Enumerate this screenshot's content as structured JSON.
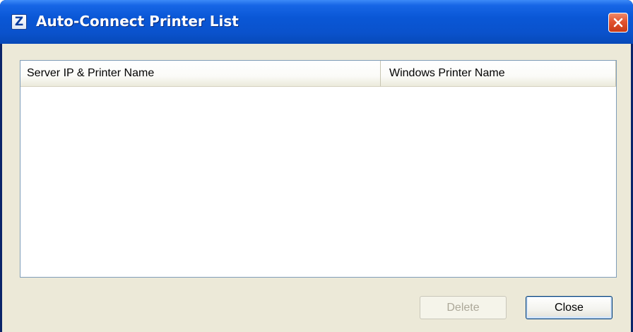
{
  "window": {
    "title": "Auto-Connect Printer List",
    "app_icon_letter": "Z",
    "close_icon": "close-x-icon"
  },
  "list": {
    "columns": [
      {
        "label": "Server IP & Printer Name"
      },
      {
        "label": "Windows Printer Name"
      }
    ],
    "rows": []
  },
  "buttons": {
    "delete_label": "Delete",
    "delete_enabled": false,
    "close_label": "Close"
  },
  "colors": {
    "titlebar": "#0a52cc",
    "client_background": "#ece9d8",
    "close_button": "#e2532f",
    "list_border": "#7f9db9"
  }
}
